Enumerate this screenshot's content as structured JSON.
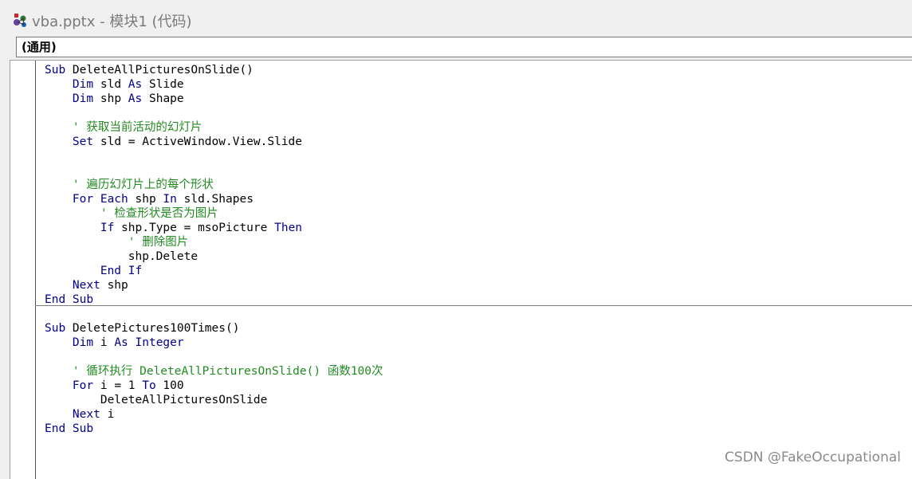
{
  "window": {
    "title": "vba.pptx - 模块1 (代码)"
  },
  "object_combo": {
    "selected": "(通用)"
  },
  "watermark": "CSDN @FakeOccupational",
  "colors": {
    "keyword": "#00008b",
    "comment": "#228b22",
    "text": "#000000"
  },
  "code": {
    "proc1": [
      [
        [
          "k",
          "Sub"
        ],
        [
          "t",
          " DeleteAllPicturesOnSlide()"
        ]
      ],
      [
        [
          "t",
          "    "
        ],
        [
          "k",
          "Dim"
        ],
        [
          "t",
          " sld "
        ],
        [
          "k",
          "As"
        ],
        [
          "t",
          " Slide"
        ]
      ],
      [
        [
          "t",
          "    "
        ],
        [
          "k",
          "Dim"
        ],
        [
          "t",
          " shp "
        ],
        [
          "k",
          "As"
        ],
        [
          "t",
          " Shape"
        ]
      ],
      [],
      [
        [
          "t",
          "    "
        ],
        [
          "c",
          "' 获取当前活动的幻灯片"
        ]
      ],
      [
        [
          "t",
          "    "
        ],
        [
          "k",
          "Set"
        ],
        [
          "t",
          " sld = ActiveWindow.View.Slide"
        ]
      ],
      [],
      [],
      [
        [
          "t",
          "    "
        ],
        [
          "c",
          "' 遍历幻灯片上的每个形状"
        ]
      ],
      [
        [
          "t",
          "    "
        ],
        [
          "k",
          "For Each"
        ],
        [
          "t",
          " shp "
        ],
        [
          "k",
          "In"
        ],
        [
          "t",
          " sld.Shapes"
        ]
      ],
      [
        [
          "t",
          "        "
        ],
        [
          "c",
          "' 检查形状是否为图片"
        ]
      ],
      [
        [
          "t",
          "        "
        ],
        [
          "k",
          "If"
        ],
        [
          "t",
          " shp.Type = msoPicture "
        ],
        [
          "k",
          "Then"
        ]
      ],
      [
        [
          "t",
          "            "
        ],
        [
          "c",
          "' 删除图片"
        ]
      ],
      [
        [
          "t",
          "            shp.Delete"
        ]
      ],
      [
        [
          "t",
          "        "
        ],
        [
          "k",
          "End If"
        ]
      ],
      [
        [
          "t",
          "    "
        ],
        [
          "k",
          "Next"
        ],
        [
          "t",
          " shp"
        ]
      ],
      [
        [
          "k",
          "End Sub"
        ]
      ]
    ],
    "proc2": [
      [
        [
          "k",
          "Sub"
        ],
        [
          "t",
          " DeletePictures100Times()"
        ]
      ],
      [
        [
          "t",
          "    "
        ],
        [
          "k",
          "Dim"
        ],
        [
          "t",
          " i "
        ],
        [
          "k",
          "As Integer"
        ]
      ],
      [],
      [
        [
          "t",
          "    "
        ],
        [
          "c",
          "' 循环执行 DeleteAllPicturesOnSlide() 函数100次"
        ]
      ],
      [
        [
          "t",
          "    "
        ],
        [
          "k",
          "For"
        ],
        [
          "t",
          " i = 1 "
        ],
        [
          "k",
          "To"
        ],
        [
          "t",
          " 100"
        ]
      ],
      [
        [
          "t",
          "        DeleteAllPicturesOnSlide"
        ]
      ],
      [
        [
          "t",
          "    "
        ],
        [
          "k",
          "Next"
        ],
        [
          "t",
          " i"
        ]
      ],
      [
        [
          "k",
          "End Sub"
        ]
      ]
    ]
  }
}
